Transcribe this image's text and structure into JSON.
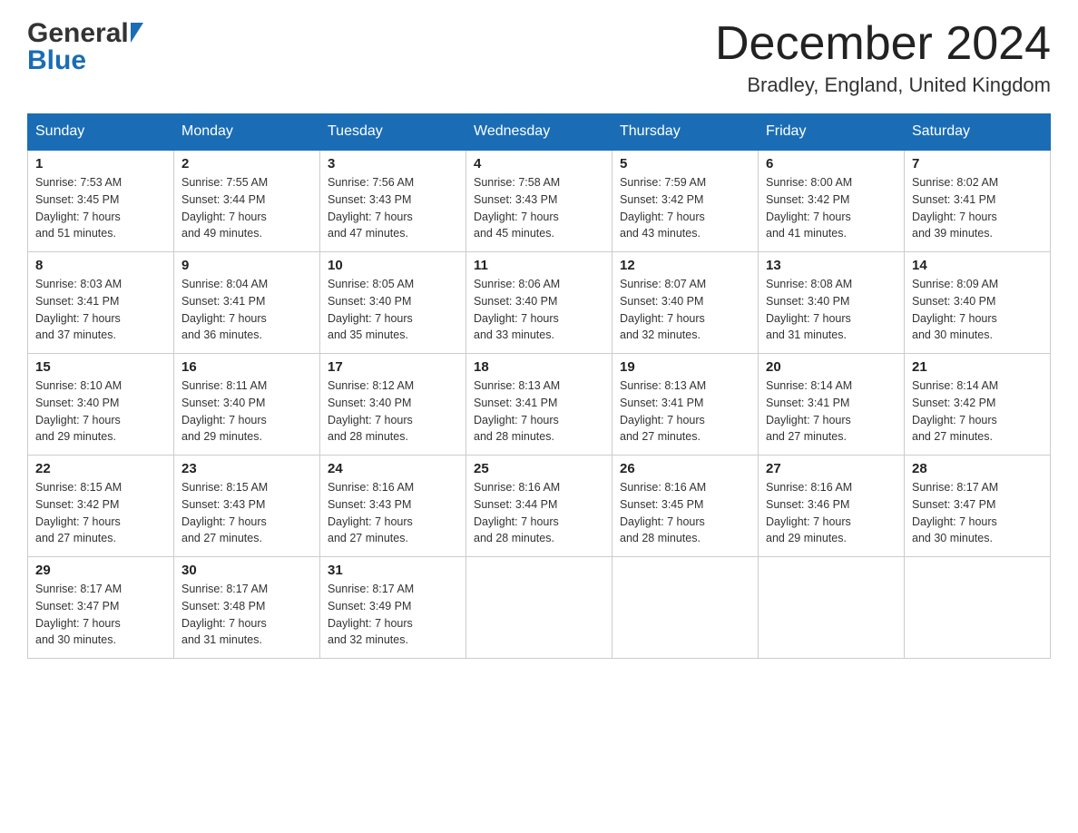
{
  "header": {
    "logo_general": "General",
    "logo_blue": "Blue",
    "title": "December 2024",
    "subtitle": "Bradley, England, United Kingdom"
  },
  "days_of_week": [
    "Sunday",
    "Monday",
    "Tuesday",
    "Wednesday",
    "Thursday",
    "Friday",
    "Saturday"
  ],
  "weeks": [
    [
      {
        "day": "1",
        "sunrise": "7:53 AM",
        "sunset": "3:45 PM",
        "daylight": "7 hours and 51 minutes."
      },
      {
        "day": "2",
        "sunrise": "7:55 AM",
        "sunset": "3:44 PM",
        "daylight": "7 hours and 49 minutes."
      },
      {
        "day": "3",
        "sunrise": "7:56 AM",
        "sunset": "3:43 PM",
        "daylight": "7 hours and 47 minutes."
      },
      {
        "day": "4",
        "sunrise": "7:58 AM",
        "sunset": "3:43 PM",
        "daylight": "7 hours and 45 minutes."
      },
      {
        "day": "5",
        "sunrise": "7:59 AM",
        "sunset": "3:42 PM",
        "daylight": "7 hours and 43 minutes."
      },
      {
        "day": "6",
        "sunrise": "8:00 AM",
        "sunset": "3:42 PM",
        "daylight": "7 hours and 41 minutes."
      },
      {
        "day": "7",
        "sunrise": "8:02 AM",
        "sunset": "3:41 PM",
        "daylight": "7 hours and 39 minutes."
      }
    ],
    [
      {
        "day": "8",
        "sunrise": "8:03 AM",
        "sunset": "3:41 PM",
        "daylight": "7 hours and 37 minutes."
      },
      {
        "day": "9",
        "sunrise": "8:04 AM",
        "sunset": "3:41 PM",
        "daylight": "7 hours and 36 minutes."
      },
      {
        "day": "10",
        "sunrise": "8:05 AM",
        "sunset": "3:40 PM",
        "daylight": "7 hours and 35 minutes."
      },
      {
        "day": "11",
        "sunrise": "8:06 AM",
        "sunset": "3:40 PM",
        "daylight": "7 hours and 33 minutes."
      },
      {
        "day": "12",
        "sunrise": "8:07 AM",
        "sunset": "3:40 PM",
        "daylight": "7 hours and 32 minutes."
      },
      {
        "day": "13",
        "sunrise": "8:08 AM",
        "sunset": "3:40 PM",
        "daylight": "7 hours and 31 minutes."
      },
      {
        "day": "14",
        "sunrise": "8:09 AM",
        "sunset": "3:40 PM",
        "daylight": "7 hours and 30 minutes."
      }
    ],
    [
      {
        "day": "15",
        "sunrise": "8:10 AM",
        "sunset": "3:40 PM",
        "daylight": "7 hours and 29 minutes."
      },
      {
        "day": "16",
        "sunrise": "8:11 AM",
        "sunset": "3:40 PM",
        "daylight": "7 hours and 29 minutes."
      },
      {
        "day": "17",
        "sunrise": "8:12 AM",
        "sunset": "3:40 PM",
        "daylight": "7 hours and 28 minutes."
      },
      {
        "day": "18",
        "sunrise": "8:13 AM",
        "sunset": "3:41 PM",
        "daylight": "7 hours and 28 minutes."
      },
      {
        "day": "19",
        "sunrise": "8:13 AM",
        "sunset": "3:41 PM",
        "daylight": "7 hours and 27 minutes."
      },
      {
        "day": "20",
        "sunrise": "8:14 AM",
        "sunset": "3:41 PM",
        "daylight": "7 hours and 27 minutes."
      },
      {
        "day": "21",
        "sunrise": "8:14 AM",
        "sunset": "3:42 PM",
        "daylight": "7 hours and 27 minutes."
      }
    ],
    [
      {
        "day": "22",
        "sunrise": "8:15 AM",
        "sunset": "3:42 PM",
        "daylight": "7 hours and 27 minutes."
      },
      {
        "day": "23",
        "sunrise": "8:15 AM",
        "sunset": "3:43 PM",
        "daylight": "7 hours and 27 minutes."
      },
      {
        "day": "24",
        "sunrise": "8:16 AM",
        "sunset": "3:43 PM",
        "daylight": "7 hours and 27 minutes."
      },
      {
        "day": "25",
        "sunrise": "8:16 AM",
        "sunset": "3:44 PM",
        "daylight": "7 hours and 28 minutes."
      },
      {
        "day": "26",
        "sunrise": "8:16 AM",
        "sunset": "3:45 PM",
        "daylight": "7 hours and 28 minutes."
      },
      {
        "day": "27",
        "sunrise": "8:16 AM",
        "sunset": "3:46 PM",
        "daylight": "7 hours and 29 minutes."
      },
      {
        "day": "28",
        "sunrise": "8:17 AM",
        "sunset": "3:47 PM",
        "daylight": "7 hours and 30 minutes."
      }
    ],
    [
      {
        "day": "29",
        "sunrise": "8:17 AM",
        "sunset": "3:47 PM",
        "daylight": "7 hours and 30 minutes."
      },
      {
        "day": "30",
        "sunrise": "8:17 AM",
        "sunset": "3:48 PM",
        "daylight": "7 hours and 31 minutes."
      },
      {
        "day": "31",
        "sunrise": "8:17 AM",
        "sunset": "3:49 PM",
        "daylight": "7 hours and 32 minutes."
      },
      null,
      null,
      null,
      null
    ]
  ],
  "sunrise_label": "Sunrise:",
  "sunset_label": "Sunset:",
  "daylight_label": "Daylight:"
}
